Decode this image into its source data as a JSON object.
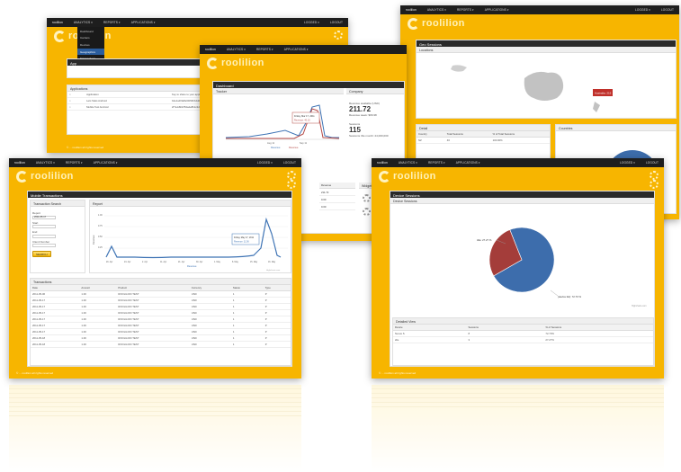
{
  "brand": "roolilion",
  "nav": {
    "app_brand": "roolilion",
    "analytics": "ANALYTICS ▾",
    "reports": "REPORTS ▾",
    "applications": "APPLICATIONS ▾",
    "login": "LOGGED ▾",
    "logout": "LOGOUT"
  },
  "win1": {
    "menu": [
      "Dashboard",
      "Carriers",
      "Devices",
      "Geographics",
      "Transactions",
      "Platforms",
      "Versions"
    ],
    "panel_title": "App",
    "apps_title": "Applications",
    "apps_rows": [
      {
        "name": "Application",
        "desc": "Key to share to your application code under"
      },
      {
        "name": "Lets Stats Android",
        "desc": "b4e1a1f3a8e64f93bb4d23a09eb5fd87"
      },
      {
        "name": "Mobile Test Android",
        "desc": "2f7a1d93cf54a4e8b1c2d7f0c8de22a1bb9f"
      }
    ],
    "footer": "© ... roolilion all rights reserved"
  },
  "win2": {
    "title": "Dashboard",
    "tracker": "Tracker",
    "company": "Company",
    "revenue_label": "Revenue available (USD)",
    "revenue_value": "211.72",
    "revenue_sub": "Revenue week: $66.98",
    "sessions_label": "Sessions",
    "sessions_value": "115",
    "sessions_sub": "Sessions this month: 24,000,000",
    "tooltip_date": "Friday, Mar 17, 2011",
    "tooltip_value": "Revenue: 40.15",
    "x_labels": [
      "Aug 11",
      "Sep 11"
    ],
    "legend": [
      "Revenue",
      "Revenue"
    ],
    "table_col": "Revenue",
    "table_vals": [
      "211.72",
      "0.00",
      "0.00"
    ],
    "widget_title": "Widgets"
  },
  "win3": {
    "title": "Geo Sessions",
    "locations": "Locations",
    "marker": "Australia: 215",
    "detail": "Detail",
    "countries": "Countries",
    "cols": [
      "Country",
      "Total Sessions",
      "% of Total Sessions"
    ],
    "row": [
      "NZ",
      "46",
      "100.00%"
    ]
  },
  "win4": {
    "title": "Mobile Transactions",
    "search_title": "Transaction Search",
    "report_title": "Report",
    "field_labels": [
      "Report",
      "Start",
      "End",
      "Client Number"
    ],
    "field_values": [
      "2011-05-17",
      "",
      "",
      ""
    ],
    "search_btn": "SEARCH",
    "x_labels": [
      "20. Apr",
      "24. Apr",
      "2. Apr",
      "11. Apr",
      "21. Apr",
      "30. Apr",
      "1. May",
      "8. May",
      "15. May",
      "16. May"
    ],
    "y_labels": [
      "1.00",
      "0.75",
      "0.50",
      "0.25"
    ],
    "y_axis": "Revenue",
    "tooltip_date": "Friday, May 17, 2011",
    "tooltip_value": "Revenue: 11.56",
    "legend": "Revenue",
    "credit": "Highcharts.com",
    "transactions_title": "Transactions",
    "table_cols": [
      "Date",
      "Amount",
      "Product",
      "Currency",
      "Status",
      "Type"
    ],
    "table_rows": [
      [
        "2011-05-06",
        "1.00",
        "ROOLILION TEST",
        "USD",
        "1",
        "P"
      ],
      [
        "2011-05-17",
        "1.00",
        "ROOLILION TEST",
        "USD",
        "1",
        "P"
      ],
      [
        "2011-05-17",
        "1.00",
        "ROOLILION TEST",
        "USD",
        "1",
        "P"
      ],
      [
        "2011-05-17",
        "1.00",
        "ROOLILION TEST",
        "USD",
        "1",
        "P"
      ],
      [
        "2011-05-17",
        "1.00",
        "ROOLILION TEST",
        "USD",
        "1",
        "P"
      ],
      [
        "2011-05-17",
        "1.00",
        "ROOLILION TEST",
        "USD",
        "1",
        "P"
      ],
      [
        "2011-05-17",
        "1.00",
        "ROOLILION TEST",
        "USD",
        "1",
        "P"
      ],
      [
        "2011-05-18",
        "1.00",
        "ROOLILION TEST",
        "USD",
        "1",
        "P"
      ],
      [
        "2011-05-18",
        "1.00",
        "ROOLILION TEST",
        "USD",
        "1",
        "P"
      ]
    ],
    "footer": "© ... roolilion all rights reserved"
  },
  "win5": {
    "title": "Device Sessions",
    "sub": "Device Sessions",
    "pie_label_a": "Idle: 27.27 %",
    "pie_label_b": "(device list): 72.73 %",
    "credit": "Highcharts.com",
    "detail_title": "Detailed View",
    "cols": [
      "Device",
      "Sessions",
      "% of Sessions"
    ],
    "rows": [
      [
        "Nexus S",
        "8",
        "72.73%"
      ],
      [
        "idle",
        "3",
        "27.27%"
      ]
    ],
    "footer": "© ... roolilion all rights reserved"
  },
  "colors": {
    "brand_yellow": "#f7b500",
    "topbar": "#1e1e1e",
    "pie_blue": "#3d6dac",
    "pie_red": "#a43d3a",
    "line_blue": "#3f74b5",
    "line_red": "#b54a47"
  },
  "chart_data": [
    {
      "type": "pie",
      "title": "",
      "slices": [
        {
          "label": "(device list)",
          "value": 72.73
        },
        {
          "label": "Idle",
          "value": 27.27
        }
      ]
    }
  ]
}
